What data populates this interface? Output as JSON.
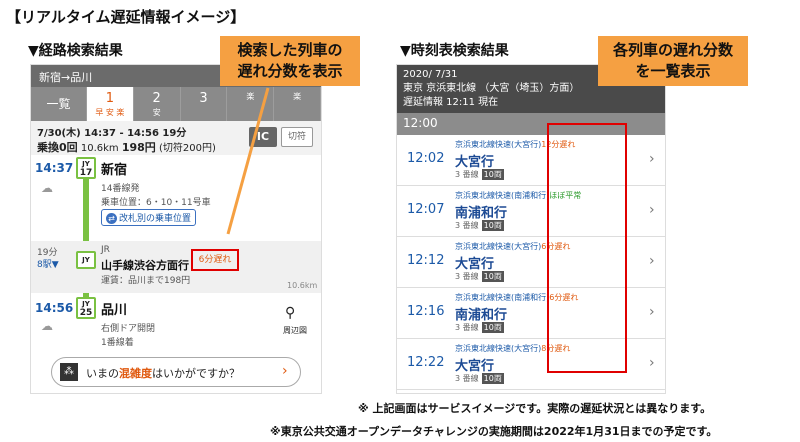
{
  "page_heading": "【リアルタイム遅延情報イメージ】",
  "left": {
    "section_title": "▼経路検索結果",
    "route_header": "新宿→品川",
    "tabs": [
      {
        "label": "一覧",
        "sub": ""
      },
      {
        "label": "1",
        "sub": "早 安 楽"
      },
      {
        "label": "2",
        "sub": "安"
      },
      {
        "label": "3",
        "sub": ""
      },
      {
        "label": "",
        "sub": "楽"
      },
      {
        "label": "",
        "sub": "楽"
      }
    ],
    "summary_line1": "7/30(木) 14:37 - 14:56 19分",
    "summary_line2_a": "乗換0回",
    "summary_line2_b": "10.6km",
    "summary_line2_c": "198円",
    "summary_line2_d": "(切符200円)",
    "ic_label": "IC",
    "kippu_label": "切符",
    "from": {
      "time": "14:37",
      "jy_code": "JY",
      "jy_num": "17",
      "name": "新宿",
      "platform": "14番線発",
      "boarding": "乗車位置：6・10・11号車",
      "gate_button": "改札別の乗車位置"
    },
    "ride": {
      "duration": "19分",
      "stops": "8駅▼",
      "jy_code": "JY",
      "company": "JR",
      "line": "山手線渋谷方面行",
      "delay": "6分遅れ",
      "fare": "運賃：品川まで198円",
      "distance": "10.6km"
    },
    "to": {
      "time": "14:56",
      "jy_code": "JY",
      "jy_num": "25",
      "name": "品川",
      "door": "右側ドア開閉",
      "platform": "1番線着",
      "map_label": "周辺図"
    },
    "crowd_question_pre": "いまの",
    "crowd_question_hl": "混雑度",
    "crowd_question_post": "はいかがですか？",
    "callout": "検索した列車の\n遅れ分数を表示"
  },
  "right": {
    "section_title": "▼時刻表検索結果",
    "date": "2020/ 7/31",
    "line_info": "東京 京浜東北線 （大宮（埼玉）方面）",
    "delay_info": "遅延情報 12:11 現在",
    "hour": "12:00",
    "trains": [
      {
        "time": "12:02",
        "train": "京浜東北線快速(大宮行)",
        "delay": "12分遅れ",
        "delay_color": "#e05a10",
        "dest": "大宮行",
        "track": "3 番線",
        "cars": "10両"
      },
      {
        "time": "12:07",
        "train": "京浜東北線快速(南浦和行)",
        "delay": "ほぼ平常",
        "delay_color": "#2a9a2a",
        "dest": "南浦和行",
        "track": "3 番線",
        "cars": "10両"
      },
      {
        "time": "12:12",
        "train": "京浜東北線快速(大宮行)",
        "delay": "6分遅れ",
        "delay_color": "#e05a10",
        "dest": "大宮行",
        "track": "3 番線",
        "cars": "10両"
      },
      {
        "time": "12:16",
        "train": "京浜東北線快速(南浦和行)",
        "delay": "6分遅れ",
        "delay_color": "#e05a10",
        "dest": "南浦和行",
        "track": "3 番線",
        "cars": "10両"
      },
      {
        "time": "12:22",
        "train": "京浜東北線快速(大宮行)",
        "delay": "8分遅れ",
        "delay_color": "#e05a10",
        "dest": "大宮行",
        "track": "3 番線",
        "cars": "10両"
      }
    ],
    "callout": "各列車の遅れ分数\nを一覧表示"
  },
  "footnote1": "※ 上記画面はサービスイメージです。実際の遅延状況とは異なります。",
  "footnote2": "※東京公共交通オープンデータチャレンジの実施期間は2022年1月31日までの予定です。",
  "colors": {
    "callout": "#f5a042",
    "highlight_box": "#e00000",
    "delay": "#e05a10",
    "jy_green": "#7ac142"
  }
}
